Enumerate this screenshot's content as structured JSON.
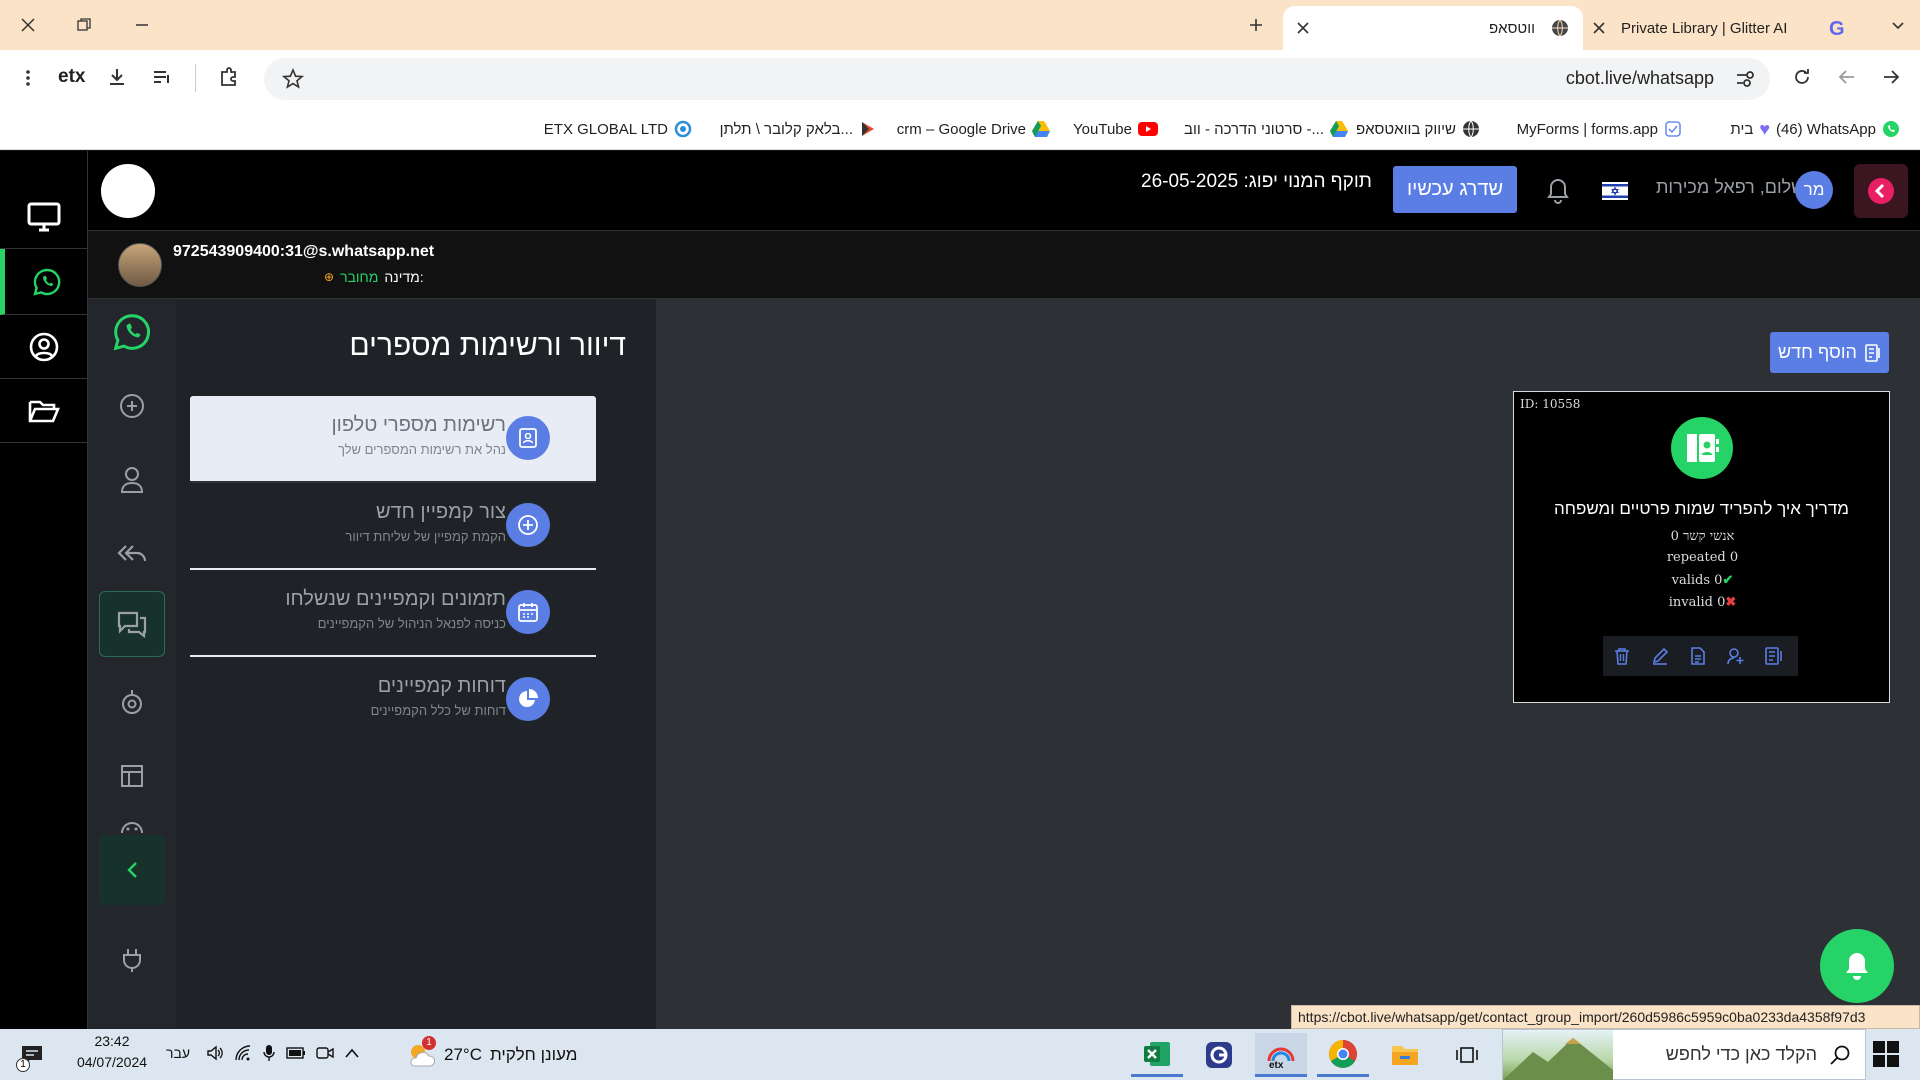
{
  "browser": {
    "tabs": [
      {
        "title": "Private Library | Glitter AI"
      },
      {
        "title": "ווטסאפ"
      }
    ],
    "url": "cbot.live/whatsapp",
    "bookmarks": [
      "(46) WhatsApp",
      "בית",
      "MyForms | forms.app",
      "שיווק בוואטסאפ",
      "סרטוני הדרכה - ווב -...",
      "YouTube",
      "crm – Google Drive",
      "בלאק קלובר \\ תלתן...",
      "ETX GLOBAL LTD"
    ]
  },
  "header": {
    "user_initials": "מר",
    "greeting": "שלום, רפאל מכירות",
    "upgrade_label": "שדרג עכשיו",
    "plan_expiry_label": "תוקף המנוי יפוג:",
    "plan_expiry_date": "26-05-2025"
  },
  "account": {
    "jid": "972543909400:31@s.whatsapp.net",
    "status_label": "מדינה:",
    "status_value": "מחובר"
  },
  "panel": {
    "title": "דיוור ורשימות מספרים",
    "items": [
      {
        "title": "רשימות מספרי טלפון",
        "subtitle": "נהל את רשימות המספרים שלך"
      },
      {
        "title": "צור קמפיין חדש",
        "subtitle": "הקמת קמפיין של שליחת דיוור"
      },
      {
        "title": "תזמונים וקמפיינים שנשלחו",
        "subtitle": "כניסה לפנאל הניהול של הקמפיינים"
      },
      {
        "title": "דוחות קמפיינים",
        "subtitle": "דוחות של כלל הקמפיינים"
      }
    ]
  },
  "content": {
    "add_new_label": "הוסף חדש",
    "card": {
      "id_label": "ID: 10558",
      "title": "מדריך איך להפריד שמות פרטיים ומשפחה",
      "contacts": "0 אנשי קשר",
      "repeated": "repeated 0",
      "valids": "valids 0",
      "invalid": "invalid 0"
    }
  },
  "status_url": "https://cbot.live/whatsapp/get/contact_group_import/260d5986c5959c0ba0233da4358f97d3",
  "taskbar": {
    "search_placeholder": "הקלד כאן כדי לחפש",
    "weather_temp": "27°C",
    "weather_text": "מעונן חלקית",
    "weather_badge": "1",
    "lang": "עבר",
    "time": "23:42",
    "date": "04/07/2024",
    "notif_count": "1"
  },
  "colors": {
    "accent_blue": "#5b7ee5",
    "whatsapp_green": "#25d366",
    "close_red": "#e91e63",
    "tab_bar": "#fbe3c7"
  }
}
